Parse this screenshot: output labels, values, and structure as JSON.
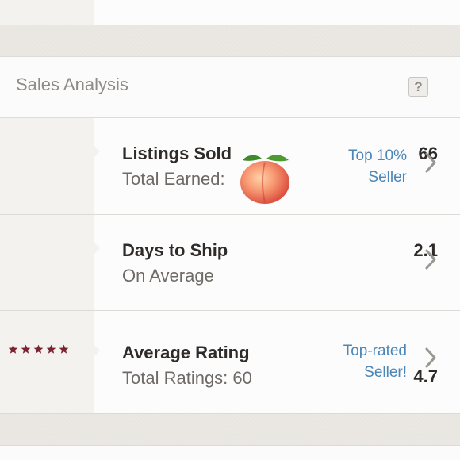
{
  "section": {
    "title": "Sales Analysis",
    "help_label": "?"
  },
  "rows": [
    {
      "stat": "66",
      "label": "Listings Sold",
      "sublabel": "Total Earned:",
      "sublabel_icon": "peach-emoji",
      "badge_line1": "Top 10%",
      "badge_line2": "Seller"
    },
    {
      "stat": "2.1",
      "label": "Days to Ship",
      "sublabel": "On Average"
    },
    {
      "stat": "4.7",
      "stars": 5,
      "label": "Average Rating",
      "sublabel": "Total Ratings: 60",
      "badge_line1": "Top-rated",
      "badge_line2": "Seller!"
    }
  ],
  "colors": {
    "accent_link": "#4a86b8",
    "star": "#7b2330",
    "text_dark": "#2e2b29",
    "text_muted": "#6e6a66"
  }
}
